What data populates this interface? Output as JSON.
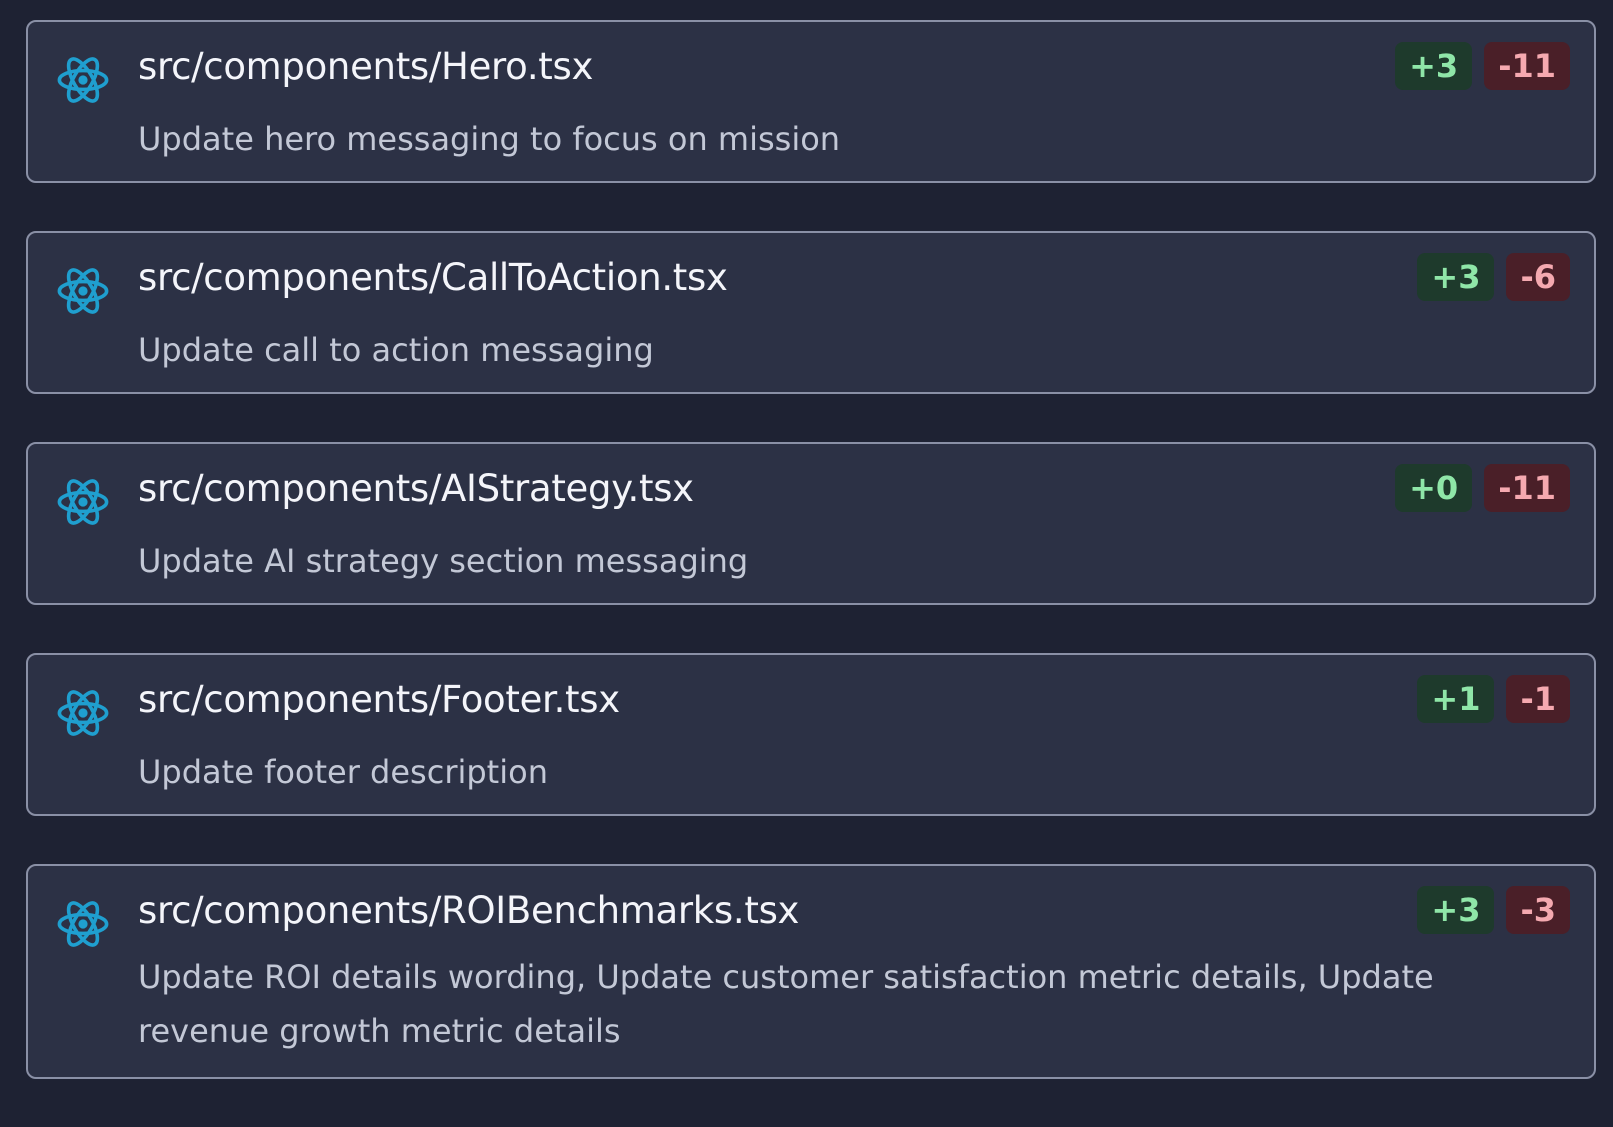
{
  "colors": {
    "background": "#1e2233",
    "card_background": "#2c3145",
    "card_border": "#8a90a6",
    "react_icon": "#1f9fcf",
    "added_bg": "#1e3a2c",
    "added_text": "#8fe6a8",
    "removed_bg": "#4a1f28",
    "removed_text": "#f5a9b0"
  },
  "files": [
    {
      "icon": "react-icon",
      "path": "src/components/Hero.tsx",
      "description": "Update hero messaging to focus on mission",
      "added": "+3",
      "removed": "-11"
    },
    {
      "icon": "react-icon",
      "path": "src/components/CallToAction.tsx",
      "description": "Update call to action messaging",
      "added": "+3",
      "removed": "-6"
    },
    {
      "icon": "react-icon",
      "path": "src/components/AIStrategy.tsx",
      "description": "Update AI strategy section messaging",
      "added": "+0",
      "removed": "-11"
    },
    {
      "icon": "react-icon",
      "path": "src/components/Footer.tsx",
      "description": "Update footer description",
      "added": "+1",
      "removed": "-1"
    },
    {
      "icon": "react-icon",
      "path": "src/components/ROIBenchmarks.tsx",
      "description": "Update ROI details wording, Update customer satisfaction metric details, Update revenue growth metric details",
      "added": "+3",
      "removed": "-3"
    }
  ]
}
